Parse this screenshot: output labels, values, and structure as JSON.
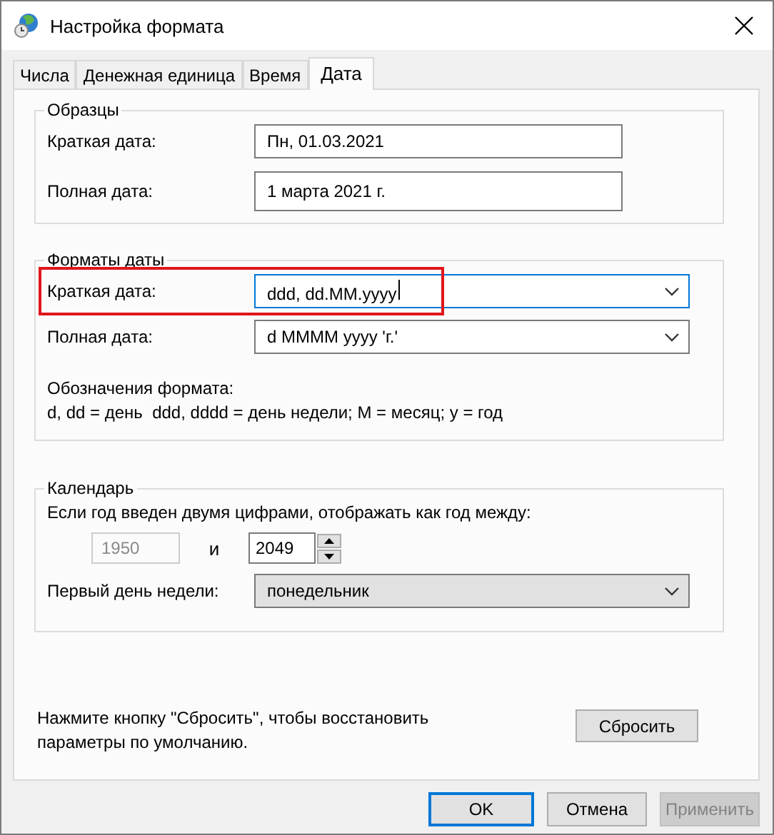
{
  "window": {
    "title": "Настройка формата"
  },
  "tabs": [
    {
      "label": "Числа",
      "selected": false
    },
    {
      "label": "Денежная единица",
      "selected": false
    },
    {
      "label": "Время",
      "selected": false
    },
    {
      "label": "Дата",
      "selected": true
    }
  ],
  "samples": {
    "title": "Образцы",
    "rows": [
      {
        "label": "Краткая дата:",
        "value": "Пн, 01.03.2021"
      },
      {
        "label": "Полная дата:",
        "value": "1 марта 2021 г."
      }
    ]
  },
  "date_formats": {
    "title": "Форматы даты",
    "rows": [
      {
        "label": "Краткая дата:",
        "value": "ddd, dd.MM.yyyy",
        "focused": true,
        "highlighted": true
      },
      {
        "label": "Полная дата:",
        "value": "d MMMM yyyy 'г.'",
        "focused": false,
        "highlighted": false
      }
    ],
    "notation_title": "Обозначения формата:",
    "notation": "d, dd = день  ddd, dddd = день недели; M = месяц; y = год"
  },
  "calendar": {
    "title": "Календарь",
    "two_digit_label": "Если год введен двумя цифрами, отображать как год между:",
    "year_from": {
      "value": "1950",
      "disabled": true
    },
    "and": "и",
    "year_to": {
      "value": "2049",
      "disabled": false
    },
    "first_day_label": "Первый день недели:",
    "first_day": "понедельник"
  },
  "reset": {
    "text": "Нажмите кнопку \"Сбросить\", чтобы восстановить параметры по умолчанию.",
    "button": "Сбросить"
  },
  "buttons": [
    {
      "label": "OK",
      "default": true,
      "disabled": false
    },
    {
      "label": "Отмена",
      "default": false,
      "disabled": false
    },
    {
      "label": "Применить",
      "default": false,
      "disabled": true
    }
  ]
}
